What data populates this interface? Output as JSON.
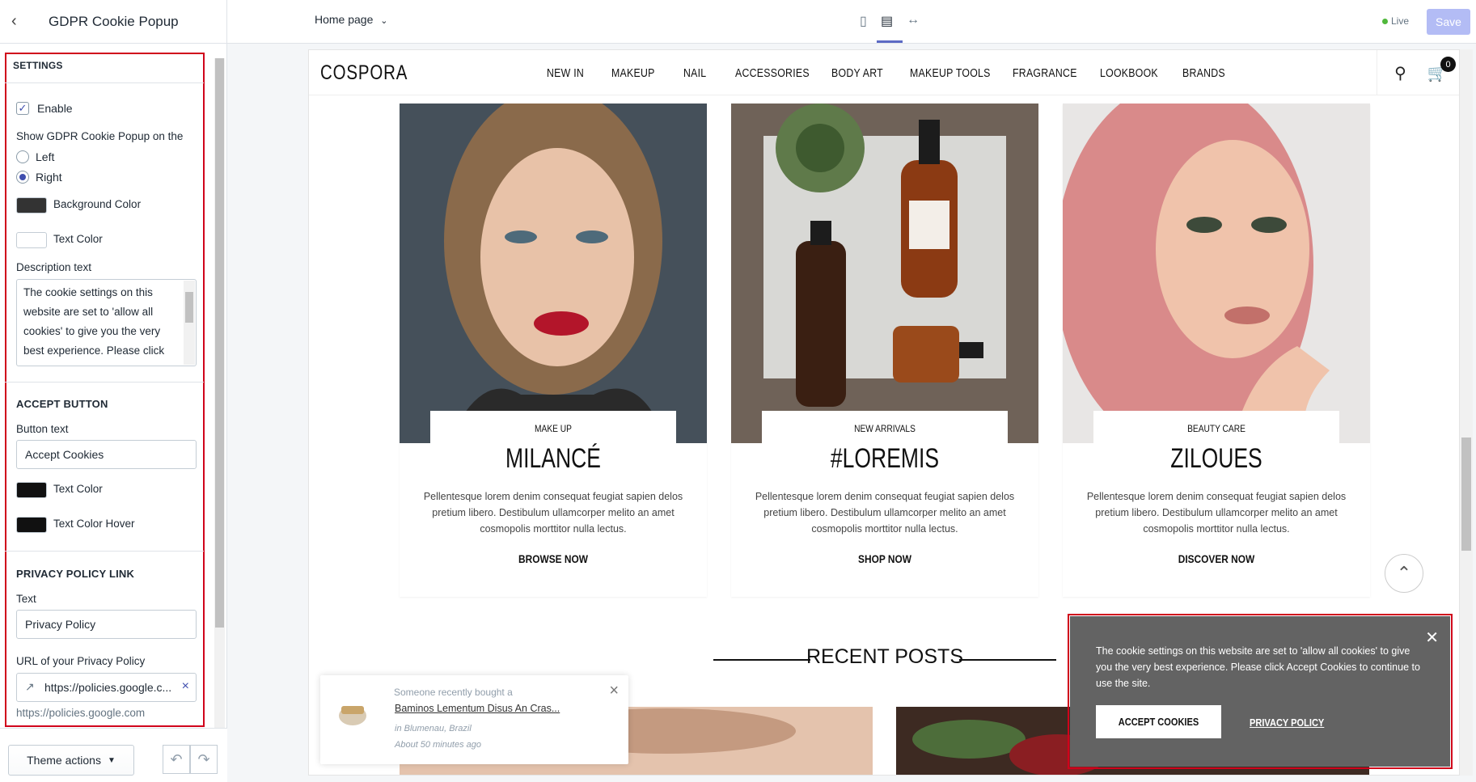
{
  "sidebar": {
    "title": "GDPR Cookie Popup",
    "settings_title": "SETTINGS",
    "enable_label": "Enable",
    "position_label": "Show GDPR Cookie Popup on the",
    "position_options": [
      "Left",
      "Right"
    ],
    "position_selected": "Right",
    "bg_color_label": "Background Color",
    "bg_color": "#333333",
    "text_color_label": "Text Color",
    "text_color": "#ffffff",
    "desc_label": "Description text",
    "desc_value": "The cookie settings on this website are set to 'allow all cookies' to give you the very best experience. Please click",
    "accept_title": "ACCEPT BUTTON",
    "button_text_label": "Button text",
    "button_text_value": "Accept Cookies",
    "btn_text_color_label": "Text Color",
    "btn_text_color": "#111111",
    "btn_hover_label": "Text Color Hover",
    "btn_hover_color": "#111111",
    "privacy_title": "PRIVACY POLICY LINK",
    "privacy_text_label": "Text",
    "privacy_text_value": "Privacy Policy",
    "privacy_url_label": "URL of your Privacy Policy",
    "privacy_url_value": "https://policies.google.c...",
    "privacy_url_hint": "https://policies.google.com",
    "theme_actions": "Theme actions"
  },
  "topbar": {
    "page": "Home page",
    "live": "Live",
    "save": "Save"
  },
  "store": {
    "logo": "COSPORA",
    "nav": [
      "NEW IN",
      "MAKEUP",
      "NAIL",
      "ACCESSORIES",
      "BODY ART",
      "MAKEUP TOOLS",
      "FRAGRANCE",
      "LOOKBOOK",
      "BRANDS"
    ],
    "cart_count": "0",
    "cards": [
      {
        "cat": "MAKE UP",
        "title": "MILANCÉ",
        "desc": "Pellentesque lorem denim consequat feugiat sapien delos pretium libero. Destibulum ullamcorper melito an amet cosmopolis morttitor nulla lectus.",
        "cta": "BROWSE NOW"
      },
      {
        "cat": "NEW ARRIVALS",
        "title": "#LOREMIS",
        "desc": "Pellentesque lorem denim consequat feugiat sapien delos pretium libero. Destibulum ullamcorper melito an amet cosmopolis morttitor nulla lectus.",
        "cta": "SHOP NOW"
      },
      {
        "cat": "BEAUTY CARE",
        "title": "ZILOUES",
        "desc": "Pellentesque lorem denim consequat feugiat sapien delos pretium libero. Destibulum ullamcorper melito an amet cosmopolis morttitor nulla lectus.",
        "cta": "DISCOVER NOW"
      }
    ],
    "recent_posts": "RECENT POSTS"
  },
  "cookie_popup": {
    "text": "The cookie settings on this website are set to 'allow all cookies' to give you the very best experience. Please click Accept Cookies to continue to use the site.",
    "accept": "ACCEPT COOKIES",
    "privacy": "PRIVACY POLICY"
  },
  "recently_bought": {
    "line1": "Someone recently bought a",
    "product": "Baminos Lementum Disus An Cras...",
    "location": "in Blumenau, Brazil",
    "time": "About 50 minutes ago"
  }
}
